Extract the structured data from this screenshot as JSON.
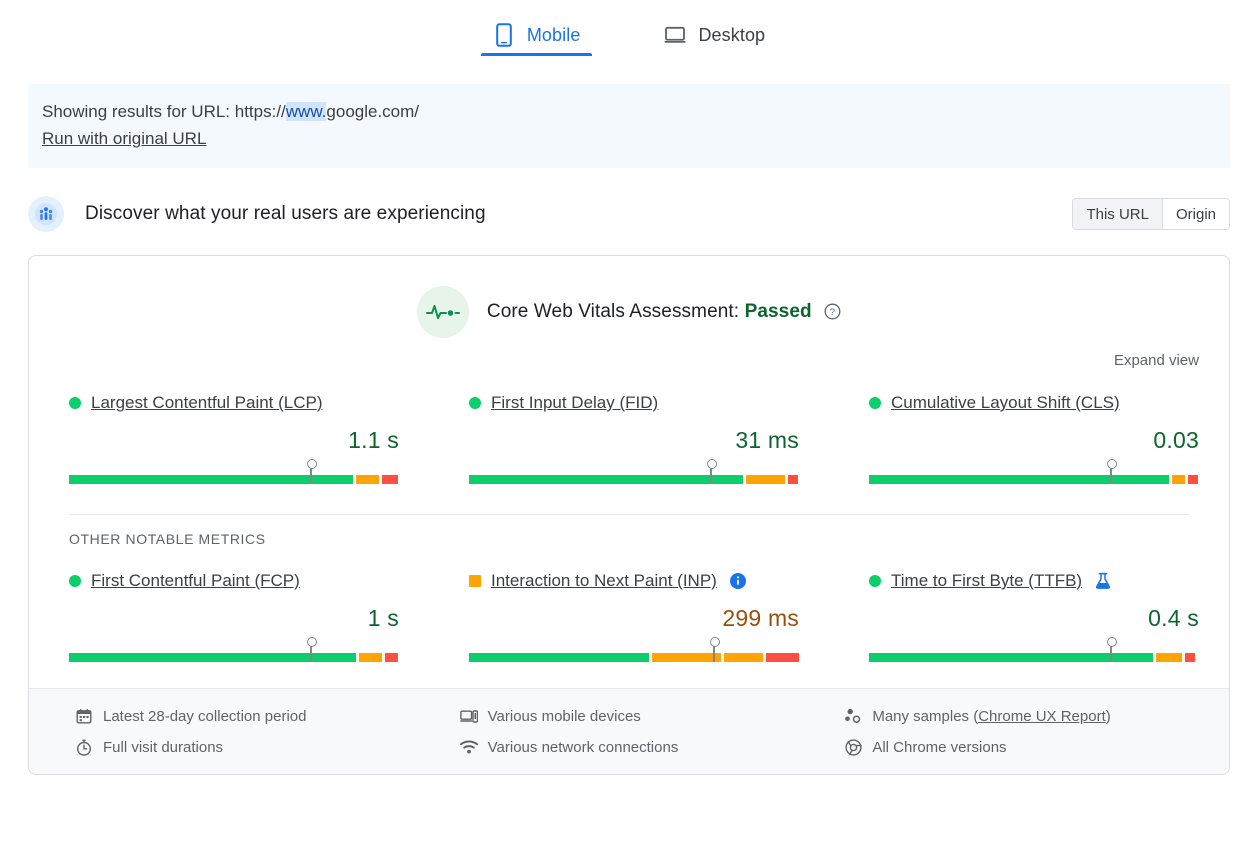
{
  "tabs": [
    {
      "label": "Mobile",
      "icon": "mobile-phone-icon",
      "active": true
    },
    {
      "label": "Desktop",
      "icon": "desktop-monitor-icon",
      "active": false
    }
  ],
  "url_banner": {
    "prefix": "Showing results for URL: https://",
    "highlight": "www.",
    "suffix": "google.com/",
    "rerun_label": "Run with original URL"
  },
  "section": {
    "avatar_icon": "crux-users-icon",
    "title": "Discover what your real users are experiencing",
    "scope": {
      "this_url": "This URL",
      "origin": "Origin",
      "selected": "This URL"
    }
  },
  "assessment": {
    "icon": "pulse-heartbeat-icon",
    "label": "Core Web Vitals Assessment:",
    "status": "Passed",
    "help_icon": "help-circle-icon",
    "expand_label": "Expand view"
  },
  "other_metrics_label": "OTHER NOTABLE METRICS",
  "core_metrics": [
    {
      "name": "Largest Contentful Paint (LCP)",
      "rating": "good",
      "value": "1.1 s",
      "marker_pct": 72,
      "distribution": [
        {
          "rating": "good",
          "pct": 86
        },
        {
          "rating": "avg",
          "pct": 7
        },
        {
          "rating": "poor",
          "pct": 5
        }
      ]
    },
    {
      "name": "First Input Delay (FID)",
      "rating": "good",
      "value": "31 ms",
      "marker_pct": 72,
      "distribution": [
        {
          "rating": "good",
          "pct": 83
        },
        {
          "rating": "avg",
          "pct": 12
        },
        {
          "rating": "poor",
          "pct": 3
        }
      ]
    },
    {
      "name": "Cumulative Layout Shift (CLS)",
      "rating": "good",
      "value": "0.03",
      "marker_pct": 72,
      "distribution": [
        {
          "rating": "good",
          "pct": 91
        },
        {
          "rating": "avg",
          "pct": 4
        },
        {
          "rating": "poor",
          "pct": 3
        }
      ]
    }
  ],
  "other_notable_metrics": [
    {
      "name": "First Contentful Paint (FCP)",
      "rating": "good",
      "value": "1 s",
      "marker_pct": 72,
      "badge_icon": null,
      "distribution": [
        {
          "rating": "good",
          "pct": 87
        },
        {
          "rating": "avg",
          "pct": 7
        },
        {
          "rating": "poor",
          "pct": 4
        }
      ]
    },
    {
      "name": "Interaction to Next Paint (INP)",
      "rating": "avg",
      "value": "299 ms",
      "marker_pct": 73,
      "badge_icon": "info-circle-icon",
      "distribution": [
        {
          "rating": "good",
          "pct": 55
        },
        {
          "rating": "avg",
          "pct": 21
        },
        {
          "rating": "avg",
          "pct": 12
        },
        {
          "rating": "poor",
          "pct": 10
        }
      ]
    },
    {
      "name": "Time to First Byte (TTFB)",
      "rating": "good",
      "value": "0.4 s",
      "marker_pct": 72,
      "badge_icon": "experiment-flask-icon",
      "distribution": [
        {
          "rating": "good",
          "pct": 86
        },
        {
          "rating": "avg",
          "pct": 8
        },
        {
          "rating": "poor",
          "pct": 3
        }
      ]
    }
  ],
  "footer": [
    {
      "icon": "calendar-icon",
      "text": "Latest 28-day collection period",
      "link": null
    },
    {
      "icon": "devices-icon",
      "text": "Various mobile devices",
      "link": null
    },
    {
      "icon": "people-samples-icon",
      "text": "Many samples (",
      "link": "Chrome UX Report",
      "after": ")"
    },
    {
      "icon": "stopwatch-icon",
      "text": "Full visit durations",
      "link": null
    },
    {
      "icon": "wifi-icon",
      "text": "Various network connections",
      "link": null
    },
    {
      "icon": "chrome-icon",
      "text": "All Chrome versions",
      "link": null
    }
  ],
  "colors": {
    "good": "#0cce6b",
    "average": "#ffa400",
    "poor": "#ff4e42",
    "link_blue": "#1a73e8",
    "good_text": "#0d652d",
    "avg_text": "#994f0a"
  }
}
